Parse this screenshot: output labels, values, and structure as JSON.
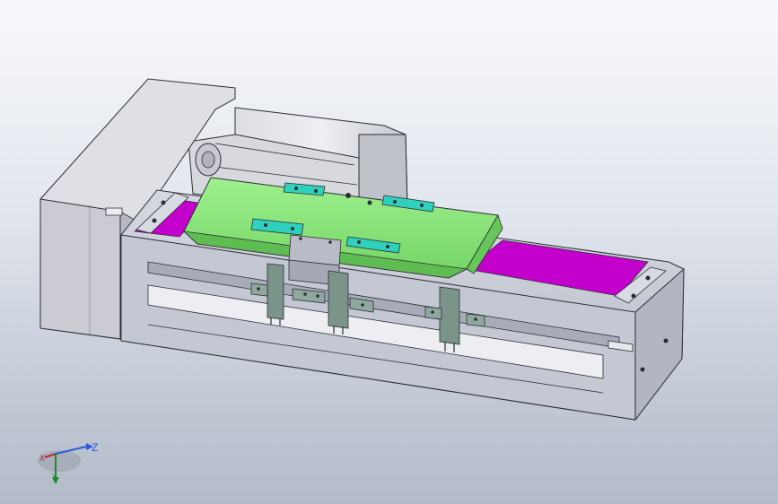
{
  "viewport": {
    "name": "cad-3d-viewport",
    "model": "linear-actuator-assembly"
  },
  "colors": {
    "background_top": "#f7f8fb",
    "background_bottom": "#b3bbc8",
    "body_gray": "#c9ccd6",
    "carriage_green": "#8ee87e",
    "belt_magenta": "#c400cc",
    "bracket_cyan": "#2fd1bd",
    "clamp_teal": "#7a948a",
    "outline": "#2c2e36",
    "axis_x": "#c02222",
    "axis_y": "#1f8a2a",
    "axis_z": "#2a5bd8"
  },
  "triad": {
    "z_label": "Z",
    "x_label": "X",
    "y_label": "Y"
  }
}
